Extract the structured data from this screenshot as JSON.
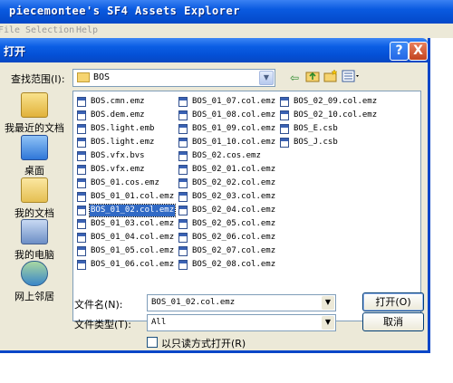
{
  "app": {
    "title": "piecemontee's SF4 Assets Explorer",
    "menus": [
      "File",
      "Selection",
      "Help"
    ]
  },
  "dialog": {
    "title": "打开",
    "help_glyph": "?",
    "close_glyph": "X",
    "look_in_label": "查找范围(I):",
    "look_in_value": "BOS",
    "places": [
      {
        "icon": "recent-documents-icon",
        "label": "我最近的文档"
      },
      {
        "icon": "desktop-icon",
        "label": "桌面"
      },
      {
        "icon": "my-documents-icon",
        "label": "我的文档"
      },
      {
        "icon": "my-computer-icon",
        "label": "我的电脑"
      },
      {
        "icon": "network-places-icon",
        "label": "网上邻居"
      }
    ],
    "files": {
      "column1": [
        "BOS.cmn.emz",
        "BOS.dem.emz",
        "BOS.light.emb",
        "BOS.light.emz",
        "BOS.vfx.bvs",
        "BOS.vfx.emz",
        "BOS_01.cos.emz",
        "BOS_01_01.col.emz",
        "BOS_01_02.col.emz",
        "BOS_01_03.col.emz",
        "BOS_01_04.col.emz",
        "BOS_01_05.col.emz",
        "BOS_01_06.col.emz"
      ],
      "column2": [
        "BOS_01_07.col.emz",
        "BOS_01_08.col.emz",
        "BOS_01_09.col.emz",
        "BOS_01_10.col.emz",
        "BOS_02.cos.emz",
        "BOS_02_01.col.emz",
        "BOS_02_02.col.emz",
        "BOS_02_03.col.emz",
        "BOS_02_04.col.emz",
        "BOS_02_05.col.emz",
        "BOS_02_06.col.emz",
        "BOS_02_07.col.emz",
        "BOS_02_08.col.emz"
      ],
      "column3": [
        "BOS_02_09.col.emz",
        "BOS_02_10.col.emz",
        "BOS_E.csb",
        "BOS_J.csb"
      ],
      "selected": "BOS_01_02.col.emz"
    },
    "filename_label": "文件名(N):",
    "filename_value": "BOS_01_02.col.emz",
    "filetype_label": "文件类型(T):",
    "filetype_value": "All",
    "open_button": "打开(O)",
    "cancel_button": "取消",
    "readonly_label": "以只读方式打开(R)",
    "readonly_checked": false
  },
  "colors": {
    "titlebar": "#0a5ae0",
    "dialog_bg": "#ece9d8",
    "selection": "#316ac5",
    "close_button": "#c2431f"
  }
}
